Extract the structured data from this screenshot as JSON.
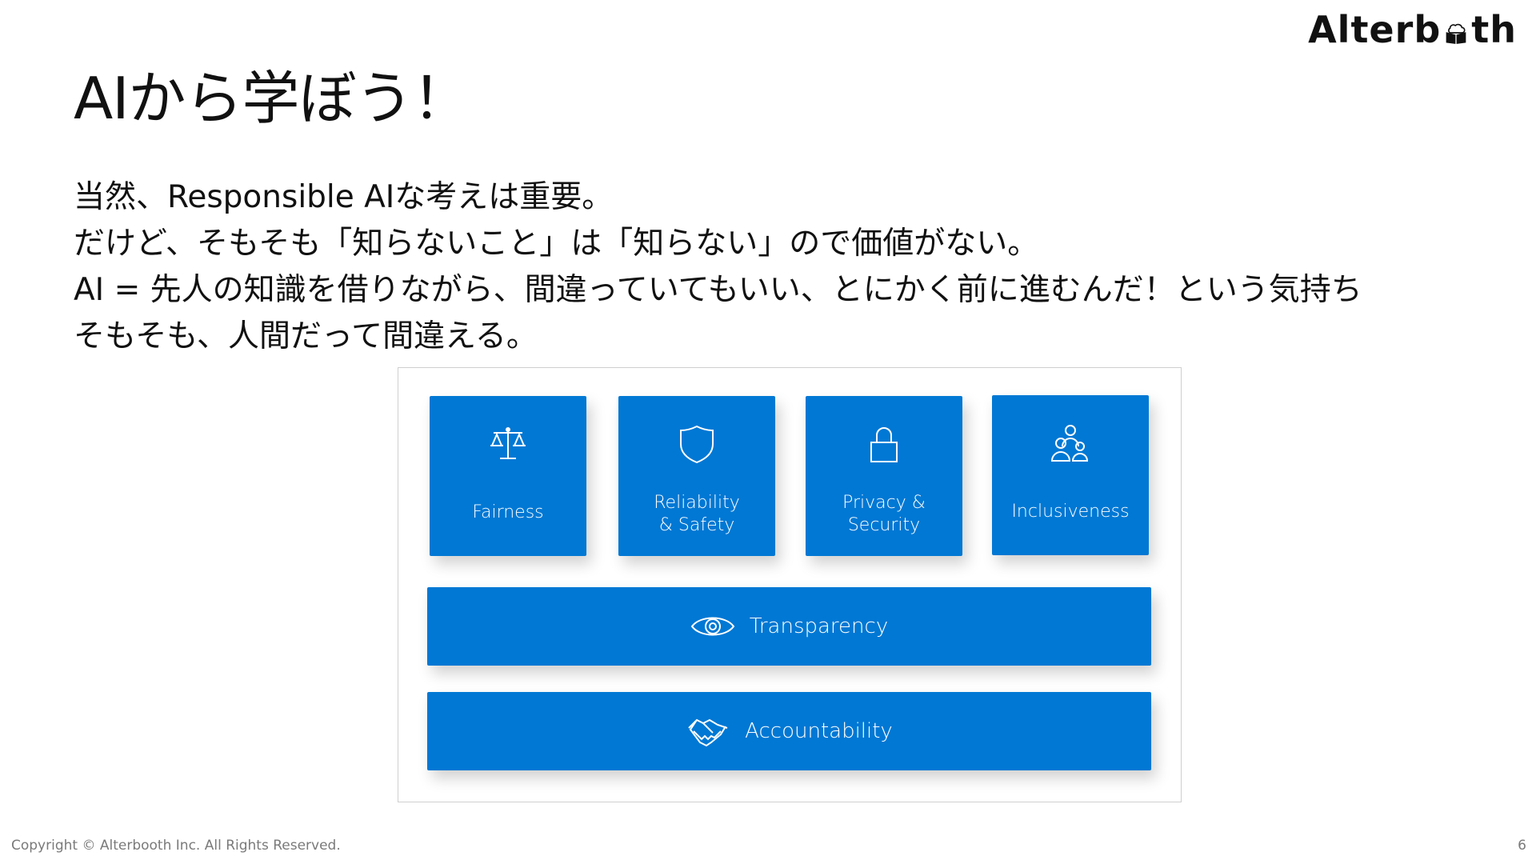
{
  "logo": {
    "text_left": "Alterb",
    "text_right": "th",
    "full": "Alterbooth"
  },
  "slide": {
    "title": "AIから学ぼう！",
    "lines": [
      "当然、Responsible AIな考えは重要。",
      "だけど、そもそも「知らないこと」は「知らない」ので価値がない。",
      "AI = 先人の知識を借りながら、間違っていてもいい、とにかく前に進むんだ！という気持ち",
      "そもそも、人間だって間違える。"
    ]
  },
  "principles": {
    "accent_color": "#0078d4",
    "tiles": [
      {
        "label_line1": "Fairness",
        "label_line2": "",
        "icon": "scale-icon"
      },
      {
        "label_line1": "Reliability",
        "label_line2": "& Safety",
        "icon": "shield-icon"
      },
      {
        "label_line1": "Privacy &",
        "label_line2": "Security",
        "icon": "lock-icon"
      },
      {
        "label_line1": "Inclusiveness",
        "label_line2": "",
        "icon": "people-icon"
      }
    ],
    "transparency": {
      "label": "Transparency",
      "icon": "eye-icon"
    },
    "accountability": {
      "label": "Accountability",
      "icon": "handshake-icon"
    }
  },
  "footer": {
    "copyright": "Copyright © Alterbooth Inc. All Rights Reserved.",
    "page_number": "6"
  }
}
